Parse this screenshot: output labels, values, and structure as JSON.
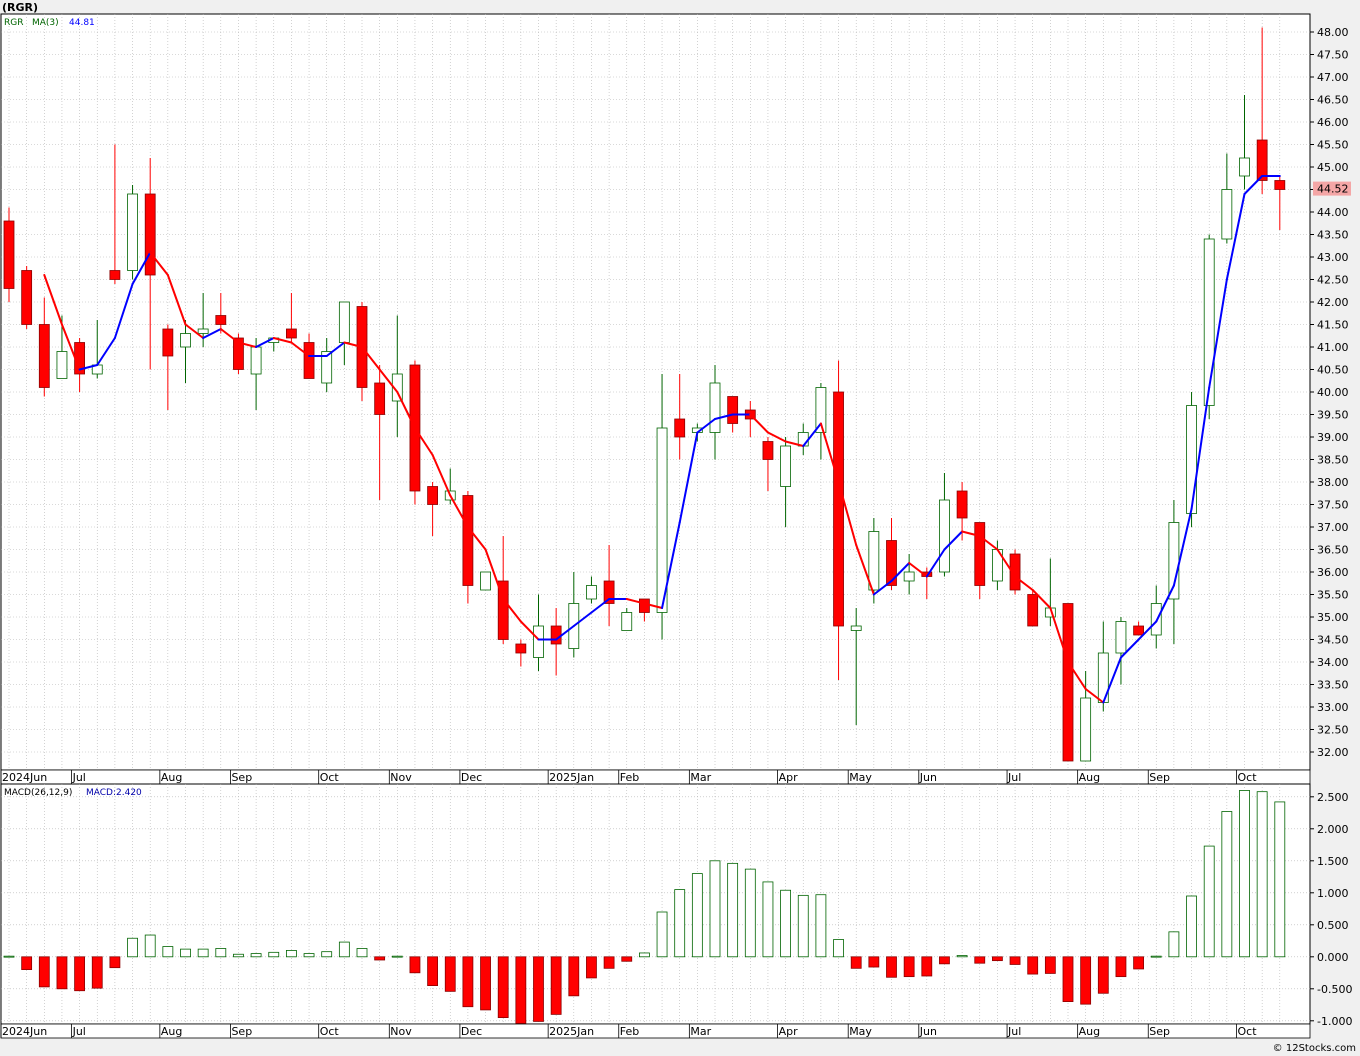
{
  "title": "(RGR)",
  "footer": "© 12Stocks.com",
  "colors": {
    "up": "#006400",
    "down": "#ff0000",
    "ma_up": "#0000ff",
    "ma_down": "#ff0000",
    "grid": "#b4b4b4",
    "price_badge": "#f4a6a6"
  },
  "chart_data": [
    {
      "type": "candlestick",
      "legend": {
        "symbol": "RGR",
        "indicator": "MA(3)",
        "value": "44.81"
      },
      "last_price": "44.52",
      "ylim": [
        31.6,
        48.4
      ],
      "yticks": [
        "32.00",
        "32.50",
        "33.00",
        "33.50",
        "34.00",
        "34.50",
        "35.00",
        "35.50",
        "36.00",
        "36.50",
        "37.00",
        "37.50",
        "38.00",
        "38.50",
        "39.00",
        "39.50",
        "40.00",
        "40.50",
        "41.00",
        "41.50",
        "42.00",
        "42.50",
        "43.00",
        "43.50",
        "44.00",
        "44.50",
        "45.00",
        "45.50",
        "46.00",
        "46.50",
        "47.00",
        "47.50",
        "48.00"
      ],
      "xlabels": [
        {
          "label": "2024Jun",
          "i": 0
        },
        {
          "label": "Jul",
          "i": 4
        },
        {
          "label": "Aug",
          "i": 9
        },
        {
          "label": "Sep",
          "i": 13
        },
        {
          "label": "Oct",
          "i": 18
        },
        {
          "label": "Nov",
          "i": 22
        },
        {
          "label": "Dec",
          "i": 26
        },
        {
          "label": "2025Jan",
          "i": 31
        },
        {
          "label": "Feb",
          "i": 35
        },
        {
          "label": "Mar",
          "i": 39
        },
        {
          "label": "Apr",
          "i": 44
        },
        {
          "label": "May",
          "i": 48
        },
        {
          "label": "Jun",
          "i": 52
        },
        {
          "label": "Jul",
          "i": 57
        },
        {
          "label": "Aug",
          "i": 61
        },
        {
          "label": "Sep",
          "i": 65
        },
        {
          "label": "Oct",
          "i": 70
        }
      ],
      "ohlc": [
        [
          43.8,
          44.1,
          42.0,
          42.3
        ],
        [
          42.7,
          42.8,
          41.4,
          41.5
        ],
        [
          41.5,
          42.1,
          39.9,
          40.1
        ],
        [
          40.3,
          41.7,
          40.3,
          40.9
        ],
        [
          41.1,
          41.2,
          40.0,
          40.4
        ],
        [
          40.4,
          41.6,
          40.3,
          40.6
        ],
        [
          42.7,
          45.5,
          42.4,
          42.5
        ],
        [
          42.7,
          44.6,
          42.5,
          44.4
        ],
        [
          44.4,
          45.2,
          40.5,
          42.6
        ],
        [
          41.4,
          41.5,
          39.6,
          40.8
        ],
        [
          41.0,
          41.6,
          40.2,
          41.3
        ],
        [
          41.3,
          42.2,
          41.0,
          41.4
        ],
        [
          41.7,
          42.2,
          41.3,
          41.5
        ],
        [
          41.2,
          41.3,
          40.4,
          40.5
        ],
        [
          40.4,
          41.2,
          39.6,
          41.0
        ],
        [
          41.1,
          41.2,
          40.9,
          41.2
        ],
        [
          41.4,
          42.2,
          41.1,
          41.2
        ],
        [
          41.1,
          41.3,
          40.3,
          40.3
        ],
        [
          40.2,
          41.2,
          40.0,
          40.9
        ],
        [
          41.1,
          42.0,
          40.6,
          42.0
        ],
        [
          41.9,
          42.0,
          39.8,
          40.1
        ],
        [
          40.2,
          40.6,
          37.6,
          39.5
        ],
        [
          39.8,
          41.7,
          39.0,
          40.4
        ],
        [
          40.6,
          40.7,
          37.5,
          37.8
        ],
        [
          37.9,
          38.0,
          36.8,
          37.5
        ],
        [
          37.6,
          38.3,
          37.5,
          37.8
        ],
        [
          37.7,
          37.8,
          35.3,
          35.7
        ],
        [
          35.6,
          36.0,
          35.6,
          36.0
        ],
        [
          35.8,
          36.8,
          34.4,
          34.5
        ],
        [
          34.4,
          34.5,
          33.9,
          34.2
        ],
        [
          34.1,
          35.5,
          33.8,
          34.8
        ],
        [
          34.8,
          35.2,
          33.7,
          34.4
        ],
        [
          34.3,
          36.0,
          34.1,
          35.3
        ],
        [
          35.4,
          35.9,
          35.3,
          35.7
        ],
        [
          35.8,
          36.6,
          34.8,
          35.3
        ],
        [
          34.7,
          35.2,
          34.7,
          35.1
        ],
        [
          35.4,
          35.4,
          34.9,
          35.1
        ],
        [
          35.1,
          40.4,
          34.5,
          39.2
        ],
        [
          39.4,
          40.4,
          38.5,
          39.0
        ],
        [
          39.1,
          39.3,
          38.9,
          39.2
        ],
        [
          39.1,
          40.6,
          38.5,
          40.2
        ],
        [
          39.9,
          39.9,
          39.1,
          39.3
        ],
        [
          39.6,
          39.8,
          39.0,
          39.4
        ],
        [
          38.9,
          39.0,
          37.8,
          38.5
        ],
        [
          37.9,
          39.0,
          37.0,
          38.8
        ],
        [
          38.8,
          39.3,
          38.6,
          39.1
        ],
        [
          39.1,
          40.2,
          38.5,
          40.1
        ],
        [
          40.0,
          40.7,
          33.6,
          34.8
        ],
        [
          34.7,
          35.2,
          32.6,
          34.8
        ],
        [
          35.6,
          37.2,
          35.3,
          36.9
        ],
        [
          36.7,
          37.2,
          35.6,
          35.7
        ],
        [
          35.8,
          36.4,
          35.5,
          36.0
        ],
        [
          36.0,
          36.1,
          35.4,
          35.9
        ],
        [
          36.0,
          38.2,
          35.9,
          37.6
        ],
        [
          37.8,
          38.0,
          36.7,
          37.2
        ],
        [
          37.1,
          37.1,
          35.4,
          35.7
        ],
        [
          35.8,
          36.7,
          35.6,
          36.5
        ],
        [
          36.4,
          36.5,
          35.5,
          35.6
        ],
        [
          35.5,
          35.6,
          34.8,
          34.8
        ],
        [
          35.0,
          36.3,
          34.8,
          35.2
        ],
        [
          35.3,
          35.3,
          31.8,
          31.8
        ],
        [
          31.8,
          33.8,
          31.8,
          33.2
        ],
        [
          33.1,
          34.9,
          32.9,
          34.2
        ],
        [
          34.2,
          35.0,
          33.5,
          34.9
        ],
        [
          34.8,
          34.9,
          34.6,
          34.6
        ],
        [
          34.6,
          35.7,
          34.3,
          35.3
        ],
        [
          35.4,
          37.6,
          34.4,
          37.1
        ],
        [
          37.3,
          40.0,
          37.0,
          39.7
        ],
        [
          39.7,
          43.5,
          39.4,
          43.4
        ],
        [
          43.4,
          45.3,
          43.3,
          44.5
        ],
        [
          44.8,
          46.6,
          44.5,
          45.2
        ],
        [
          45.6,
          48.1,
          44.4,
          44.7
        ],
        [
          44.7,
          44.8,
          43.6,
          44.5
        ]
      ],
      "ma": [
        null,
        null,
        42.6,
        41.5,
        40.5,
        40.6,
        41.2,
        42.4,
        43.1,
        42.6,
        41.5,
        41.2,
        41.4,
        41.1,
        41.0,
        41.2,
        41.1,
        40.8,
        40.8,
        41.1,
        41.0,
        40.5,
        40.0,
        39.2,
        38.6,
        37.7,
        37.0,
        36.5,
        35.4,
        34.9,
        34.5,
        34.5,
        34.8,
        35.1,
        35.4,
        35.4,
        35.3,
        35.2,
        37.1,
        39.1,
        39.4,
        39.5,
        39.5,
        39.1,
        38.9,
        38.8,
        39.3,
        38.0,
        36.6,
        35.5,
        35.8,
        36.2,
        35.9,
        36.5,
        36.9,
        36.8,
        36.5,
        35.9,
        35.6,
        35.2,
        34.0,
        33.4,
        33.1,
        34.1,
        34.5,
        34.9,
        35.7,
        37.4,
        40.1,
        42.5,
        44.4,
        44.8,
        44.8
      ],
      "macd_legend": {
        "name": "MACD(26,12,9)",
        "value": "MACD:2.420"
      },
      "macd_ylim": [
        -1.05,
        2.7
      ],
      "macd_yticks": [
        "-1.000",
        "-0.500",
        "0.000",
        "0.500",
        "1.000",
        "1.500",
        "2.000",
        "2.500"
      ],
      "macd": [
        0.01,
        -0.2,
        -0.47,
        -0.5,
        -0.53,
        -0.49,
        -0.17,
        0.29,
        0.34,
        0.16,
        0.12,
        0.12,
        0.13,
        0.04,
        0.05,
        0.07,
        0.1,
        0.05,
        0.08,
        0.23,
        0.13,
        -0.05,
        0.01,
        -0.25,
        -0.45,
        -0.54,
        -0.78,
        -0.83,
        -0.95,
        -1.04,
        -1.01,
        -0.9,
        -0.61,
        -0.33,
        -0.18,
        -0.07,
        0.06,
        0.7,
        1.05,
        1.3,
        1.5,
        1.46,
        1.37,
        1.17,
        1.04,
        0.96,
        0.97,
        0.27,
        -0.18,
        -0.16,
        -0.32,
        -0.31,
        -0.3,
        -0.11,
        0.02,
        -0.1,
        -0.06,
        -0.12,
        -0.27,
        -0.26,
        -0.7,
        -0.74,
        -0.57,
        -0.31,
        -0.19,
        0.01,
        0.39,
        0.95,
        1.73,
        2.27,
        2.6,
        2.58,
        2.42
      ]
    }
  ]
}
